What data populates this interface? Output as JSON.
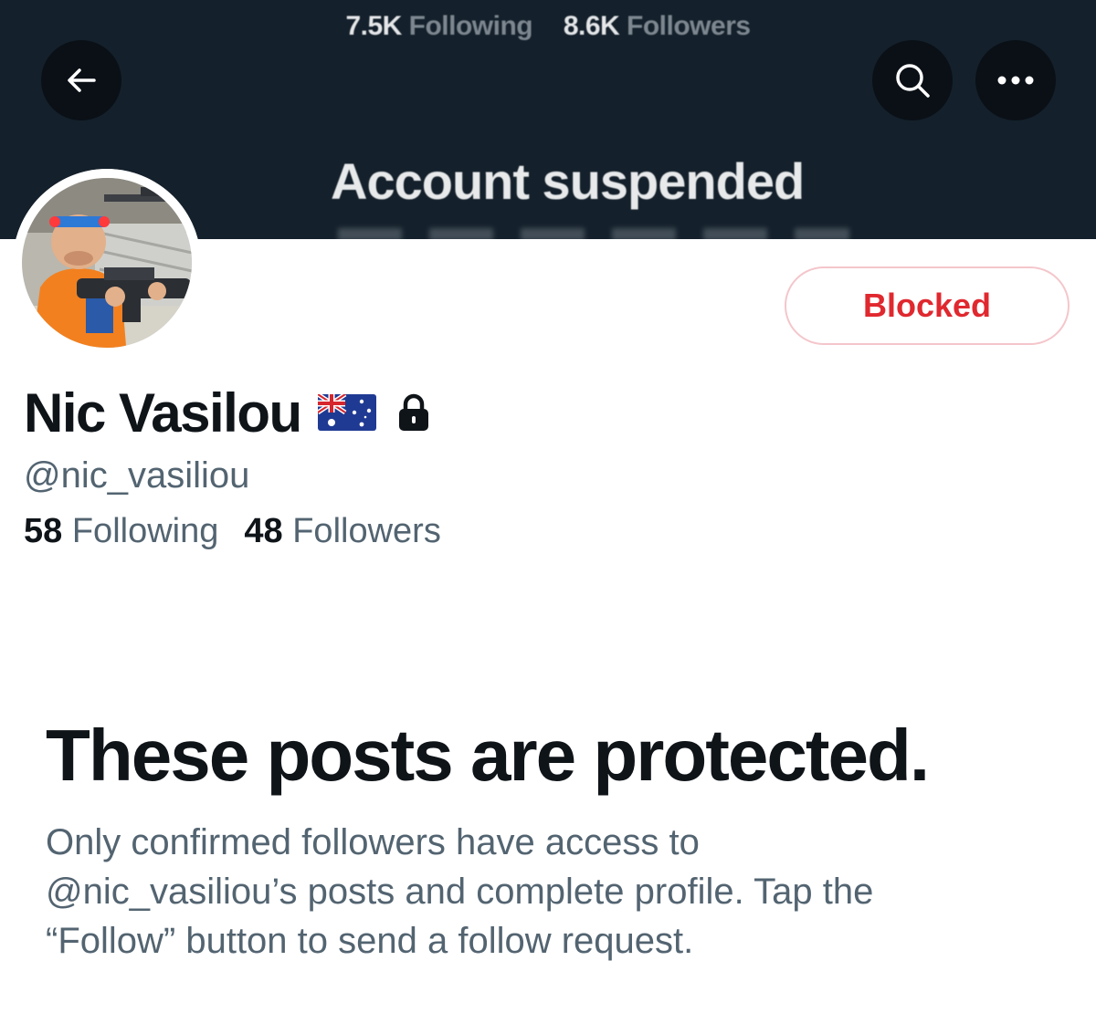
{
  "banner": {
    "following_count": "7.5K",
    "following_label": "Following",
    "followers_count": "8.6K",
    "followers_label": "Followers",
    "title": "Account suspended"
  },
  "header_buttons": {
    "back_icon": "arrow-left-icon",
    "search_icon": "search-icon",
    "more_icon": "more-horizontal-icon"
  },
  "profile": {
    "avatar": "profile-photo",
    "display_name": "Nic Vasilou",
    "flag_icon": "australia-flag-icon",
    "lock_icon": "lock-icon",
    "handle": "@nic_vasiliou",
    "following_count": "58",
    "following_label": "Following",
    "followers_count": "48",
    "followers_label": "Followers",
    "blocked_label": "Blocked"
  },
  "protected": {
    "title": "These posts are protected.",
    "line1": "Only confirmed followers have access to",
    "line2": "@nic_vasiliou’s posts and complete profile. Tap the",
    "line3": "“Follow” button to send a follow request."
  },
  "colors": {
    "banner_bg": "#14202b",
    "blocked_red": "#e0282f",
    "secondary_text": "#536471",
    "primary_text": "#0f1419"
  }
}
